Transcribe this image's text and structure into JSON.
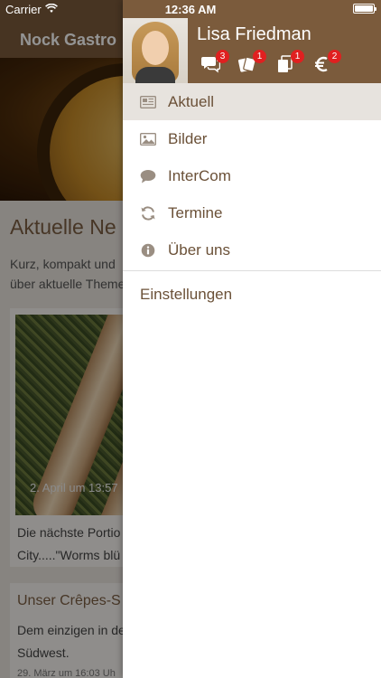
{
  "status_bar": {
    "carrier": "Carrier",
    "time": "12:36 AM"
  },
  "background_page": {
    "nav_title": "Nock Gastro",
    "section_title": "Aktuelle Ne",
    "section_text_line1": "Kurz, kompakt und",
    "section_text_line2": "über aktuelle Theme",
    "news_date": "2. April um 13:57",
    "news_text_line1": "Die nächste Portio",
    "news_text_line2": "City.....\"Worms blü",
    "card2_title": "Unser Crêpes-S",
    "card2_text_line1": "Dem einzigen in de",
    "card2_text_line2": "Südwest.",
    "card2_date": "29. März um 16:03 Uh"
  },
  "drawer": {
    "user_name": "Lisa Friedman",
    "header_icons": [
      {
        "icon": "chat-icon",
        "badge": "3"
      },
      {
        "icon": "cards-icon",
        "badge": "1"
      },
      {
        "icon": "documents-icon",
        "badge": "1"
      },
      {
        "icon": "euro-icon",
        "badge": "2"
      }
    ],
    "menu_items": [
      {
        "label": "Aktuell",
        "icon": "newspaper-icon",
        "active": true
      },
      {
        "label": "Bilder",
        "icon": "image-icon",
        "active": false
      },
      {
        "label": "InterCom",
        "icon": "speech-bubble-icon",
        "active": false
      },
      {
        "label": "Termine",
        "icon": "refresh-icon",
        "active": false
      },
      {
        "label": "Über uns",
        "icon": "info-icon",
        "active": false
      }
    ],
    "settings_label": "Einstellungen"
  },
  "colors": {
    "brand_brown": "#7b5b3c",
    "menu_text": "#6b5138",
    "active_row": "#e7e3de",
    "badge_red": "#e02020"
  }
}
